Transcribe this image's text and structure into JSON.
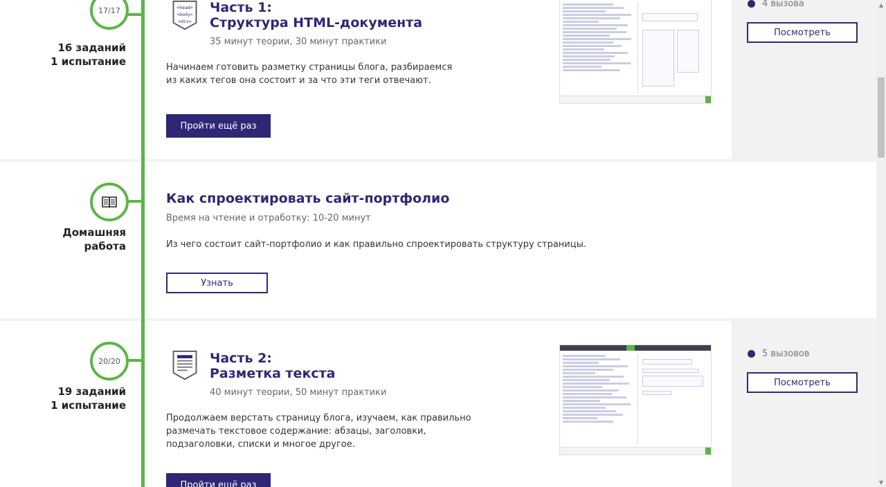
{
  "lessons": [
    {
      "progress": "17/17",
      "side_label_line1": "16 заданий",
      "side_label_line2": "1 испытание",
      "title_line1": "Часть 1:",
      "title_line2": "Структура HTML-документа",
      "meta": "35 минут теории, 30 минут практики",
      "desc_line1": "Начинаем готовить разметку страницы блога, разбираемся",
      "desc_line2": "из каких тегов она состоит и за что эти теги отвечают.",
      "button": "Пройти ещё раз",
      "calls": "4 вызова",
      "view_button": "Посмотреть",
      "icon": "html-tags-icon",
      "icon_tags": [
        "<head>",
        "<body>",
        "<div>"
      ]
    },
    {
      "side_label_line1": "Домашняя",
      "side_label_line2": "работа",
      "title": "Как спроектировать сайт-портфолио",
      "meta": "Время на чтение и отработку: 10-20 минут",
      "desc": "Из чего состоит сайт-портфолио и как правильно спроектировать структуру страницы.",
      "button": "Узнать",
      "icon": "book-icon"
    },
    {
      "progress": "20/20",
      "side_label_line1": "19 заданий",
      "side_label_line2": "1 испытание",
      "title_line1": "Часть 2:",
      "title_line2": "Разметка текста",
      "meta": "40 минут теории, 50 минут практики",
      "desc_line1": "Продолжаем верстать страницу блога, изучаем, как правильно",
      "desc_line2": "размечать текстовое содержание: абзацы, заголовки,",
      "desc_line3": "подзаголовки, списки и многое другое.",
      "button": "Пройти ещё раз",
      "calls": "5 вызовов",
      "view_button": "Посмотреть",
      "icon": "text-document-icon"
    }
  ],
  "colors": {
    "accent": "#2e2776",
    "timeline": "#5ab646",
    "aside_bg": "#f2f2f2"
  }
}
